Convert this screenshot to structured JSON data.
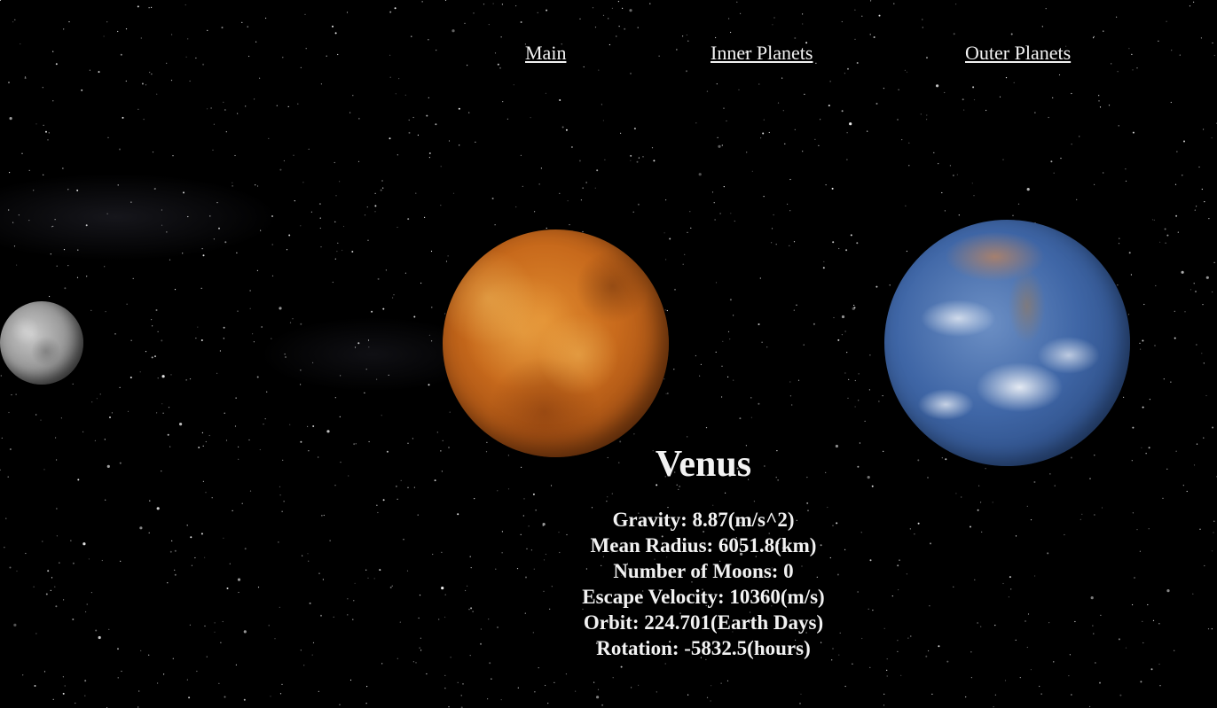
{
  "nav": {
    "main": "Main",
    "inner": "Inner Planets",
    "outer": "Outer Planets"
  },
  "planets": {
    "left": "mercury",
    "center": "venus",
    "right": "earth"
  },
  "info": {
    "name": "Venus",
    "facts": [
      "Gravity: 8.87(m/s^2)",
      "Mean Radius: 6051.8(km)",
      "Number of Moons: 0",
      "Escape Velocity: 10360(m/s)",
      "Orbit: 224.701(Earth Days)",
      "Rotation: -5832.5(hours)"
    ]
  },
  "colors": {
    "background": "#000000",
    "text": "#f2f2f2"
  }
}
